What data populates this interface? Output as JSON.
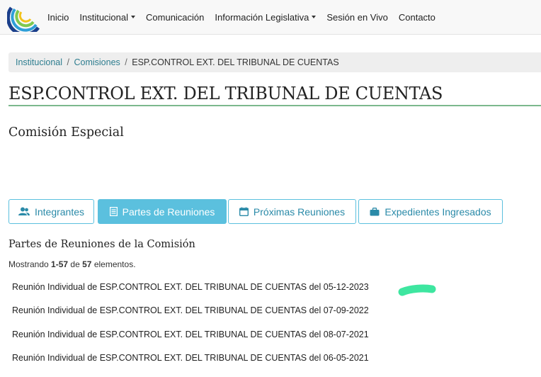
{
  "nav": {
    "items": [
      {
        "label": "Inicio",
        "dropdown": false
      },
      {
        "label": "Institucional",
        "dropdown": true
      },
      {
        "label": "Comunicación",
        "dropdown": false
      },
      {
        "label": "Información Legislativa",
        "dropdown": true
      },
      {
        "label": "Sesión en Vivo",
        "dropdown": false
      },
      {
        "label": "Contacto",
        "dropdown": false
      }
    ]
  },
  "breadcrumb": {
    "items": [
      "Institucional",
      "Comisiones"
    ],
    "current": "ESP.CONTROL EXT. DEL TRIBUNAL DE CUENTAS",
    "separator": "/"
  },
  "page": {
    "title": "ESP.CONTROL EXT. DEL TRIBUNAL DE CUENTAS",
    "subtitle": "Comisión Especial"
  },
  "tabs": [
    {
      "label": "Integrantes",
      "icon": "users-icon",
      "active": false
    },
    {
      "label": "Partes de Reuniones",
      "icon": "document-icon",
      "active": true
    },
    {
      "label": "Próximas Reuniones",
      "icon": "calendar-icon",
      "active": false
    },
    {
      "label": "Expedientes Ingresados",
      "icon": "briefcase-icon",
      "active": false
    }
  ],
  "section": {
    "heading": "Partes de Reuniones de la Comisión",
    "summary": {
      "prefix": "Mostrando",
      "range": "1-57",
      "middle": "de",
      "total": "57",
      "suffix": "elementos."
    }
  },
  "meetings": [
    "Reunión Individual de ESP.CONTROL EXT. DEL TRIBUNAL DE CUENTAS del 05-12-2023",
    "Reunión Individual de ESP.CONTROL EXT. DEL TRIBUNAL DE CUENTAS del 07-09-2022",
    "Reunión Individual de ESP.CONTROL EXT. DEL TRIBUNAL DE CUENTAS del 08-07-2021",
    "Reunión Individual de ESP.CONTROL EXT. DEL TRIBUNAL DE CUENTAS del 06-05-2021"
  ],
  "colors": {
    "accent": "#5bc0de",
    "link": "#2e7d8f",
    "title_rule": "#7cb88d",
    "highlight": "#3ee6a0"
  }
}
